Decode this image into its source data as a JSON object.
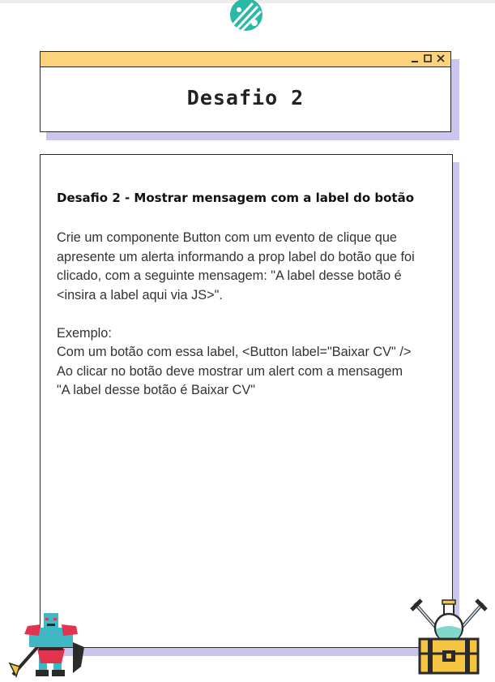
{
  "window": {
    "title": "Desafio 2",
    "controls": {
      "minimize": "_",
      "maximize": "□",
      "close": "×"
    }
  },
  "card": {
    "heading": "Desafio 2 - Mostrar mensagem com a label do botão",
    "paragraph": "Crie um componente Button com um evento de clique que apresente um alerta informando a prop label do botão que foi clicado, com a seguinte mensagem: \"A label desse botão é <insira a label aqui via JS>\".",
    "example_label": "Exemplo:",
    "example_line1": "Com um botão com essa label, <Button label=\"Baixar CV\" />",
    "example_line2": "Ao clicar no botão deve mostrar um alert com a mensagem",
    "example_line3": "\"A label desse botão é Baixar CV\""
  },
  "colors": {
    "titlebar": "#fcd37c",
    "shadow": "#cbc6ee",
    "border": "#2a2a2a"
  },
  "icons": [
    "logo-icon",
    "minimize-icon",
    "maximize-icon",
    "close-icon",
    "orc-warrior-icon",
    "treasure-chest-icon"
  ]
}
